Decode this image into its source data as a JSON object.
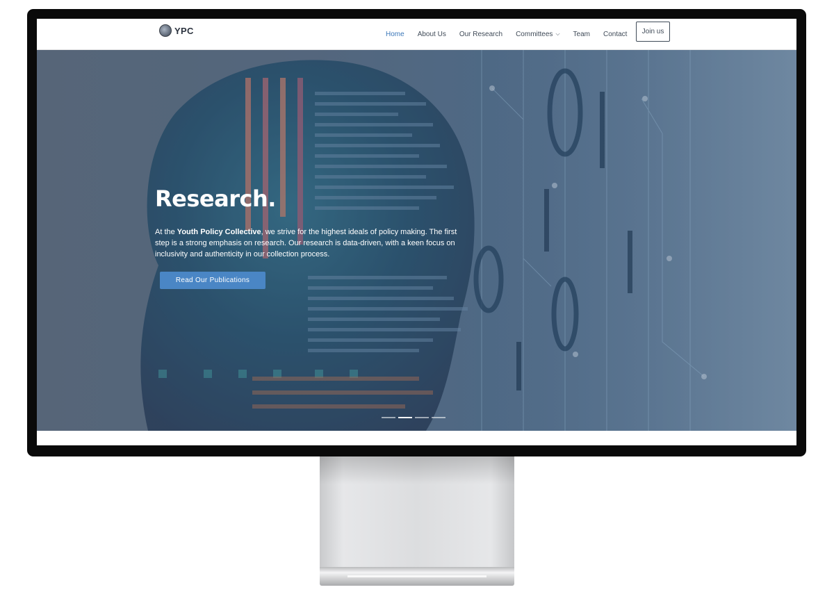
{
  "nav": {
    "logo_text": "YPC",
    "items": [
      {
        "label": "Home",
        "active": true
      },
      {
        "label": "About Us",
        "active": false
      },
      {
        "label": "Our Research",
        "active": false
      },
      {
        "label": "Committees",
        "active": false,
        "has_dropdown": true
      },
      {
        "label": "Team",
        "active": false
      },
      {
        "label": "Contact",
        "active": false
      }
    ],
    "join_label": "Join us"
  },
  "hero": {
    "title": "Research.",
    "text_before": "At the ",
    "text_bold": "Youth Policy Collective",
    "text_after": ", we strive for the highest ideals of policy making. The first step is a strong emphasis on research. Our research is data-driven, with a keen focus on inclusivity and authenticity in our collection process.",
    "button_label": "Read Our Publications",
    "slides_total": 4,
    "active_slide": 2
  },
  "colors": {
    "accent": "#4a86c5",
    "nav_active": "#3b77b8",
    "nav_text": "#3f4a57"
  }
}
